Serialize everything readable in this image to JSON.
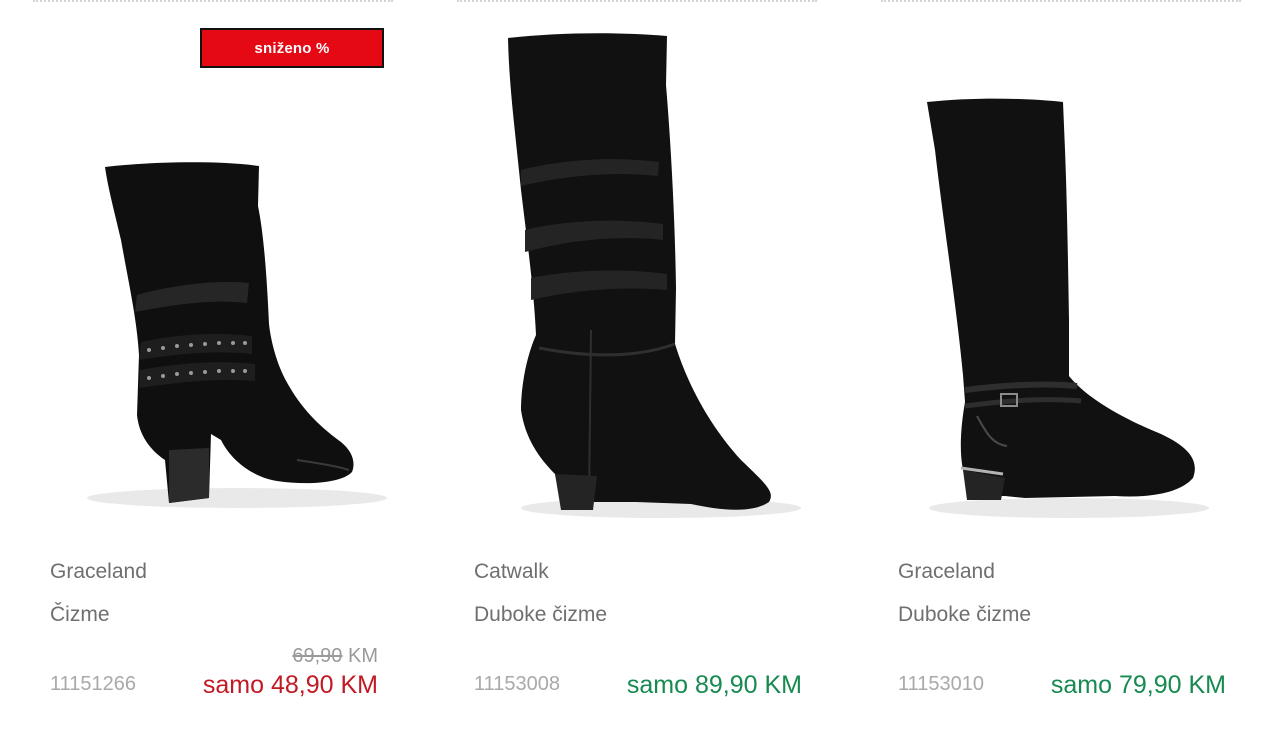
{
  "products": [
    {
      "badge": "sniženo %",
      "brand": "Graceland",
      "name": "Čizme",
      "sku": "11151266",
      "old_price_amount": "69,90",
      "old_price_currency": "KM",
      "price": "samo 48,90 KM",
      "price_state": "sale",
      "image_icon": "ankle-slouch-boot-image"
    },
    {
      "brand": "Catwalk",
      "name": "Duboke čizme",
      "sku": "11153008",
      "price": "samo 89,90 KM",
      "price_state": "regular",
      "image_icon": "knee-high-slouch-boot-image"
    },
    {
      "brand": "Graceland",
      "name": "Duboke čizme",
      "sku": "11153010",
      "price": "samo 79,90 KM",
      "price_state": "regular",
      "image_icon": "riding-boot-image"
    }
  ],
  "colors": {
    "sale_badge": "#e50914",
    "sale_price": "#c11a22",
    "regular_price": "#168a50",
    "text": "#6f6f6f",
    "sku": "#a9a9a9"
  }
}
